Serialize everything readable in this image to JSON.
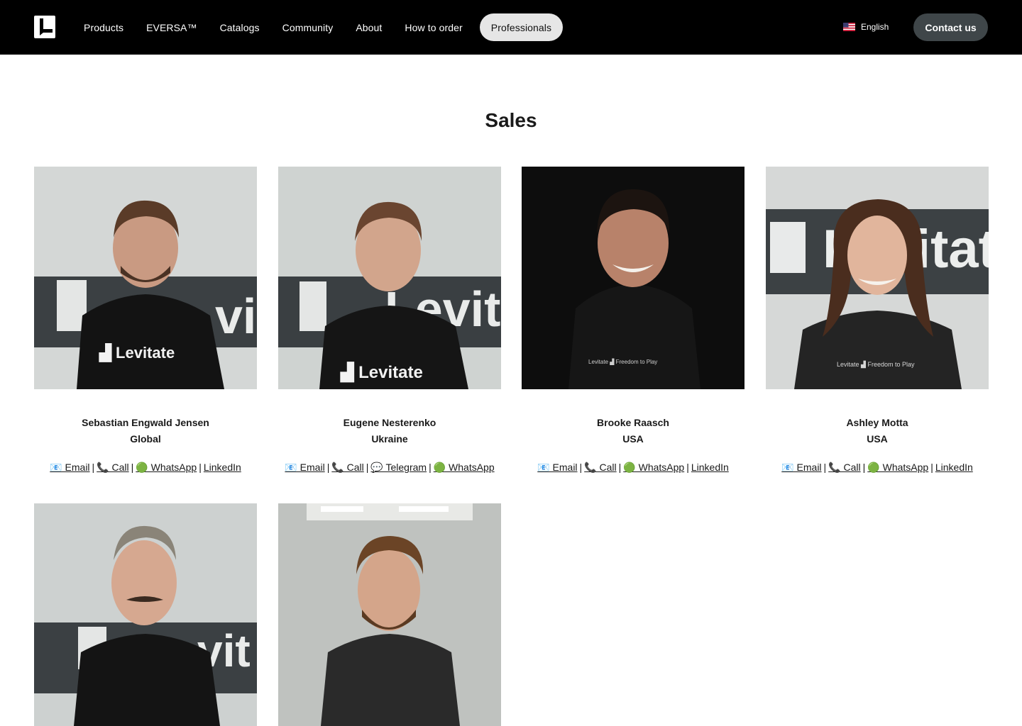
{
  "header": {
    "nav": [
      "Products",
      "EVERSA™",
      "Catalogs",
      "Community",
      "About",
      "How to order",
      "Professionals"
    ],
    "language": "English",
    "contact_label": "Contact us"
  },
  "section": {
    "title": "Sales"
  },
  "people": [
    {
      "name": "Sebastian Engwald Jensen",
      "region": "Global",
      "links": [
        "📧 Email",
        "📞 Call",
        "🟢 WhatsApp",
        "LinkedIn"
      ],
      "photo_bg": "#d4d7d6",
      "shirt_text": "Levitate"
    },
    {
      "name": "Eugene Nesterenko",
      "region": "Ukraine",
      "links": [
        "📧 Email",
        "📞 Call",
        "💬 Telegram",
        "🟢 WhatsApp"
      ],
      "photo_bg": "#cfd3d1",
      "shirt_text": "Levitate"
    },
    {
      "name": "Brooke Raasch",
      "region": "USA",
      "links": [
        "📧 Email",
        "📞 Call",
        "🟢 WhatsApp",
        "LinkedIn"
      ],
      "photo_bg": "#0d0d0d",
      "shirt_text": "Levitate Freedom to Play"
    },
    {
      "name": "Ashley Motta",
      "region": "USA",
      "links": [
        "📧 Email",
        "📞 Call",
        "🟢 WhatsApp",
        "LinkedIn"
      ],
      "photo_bg": "#d6d8d7",
      "shirt_text": "Levitate Freedom to Play"
    },
    {
      "name": "",
      "region": "",
      "links": [],
      "photo_bg": "#cdd1d0"
    },
    {
      "name": "",
      "region": "",
      "links": [],
      "photo_bg": "#bfc2bf"
    }
  ],
  "colors": {
    "header_bg": "#000000",
    "active_pill": "#e6e6e6",
    "contact_btn": "#3f4649"
  }
}
